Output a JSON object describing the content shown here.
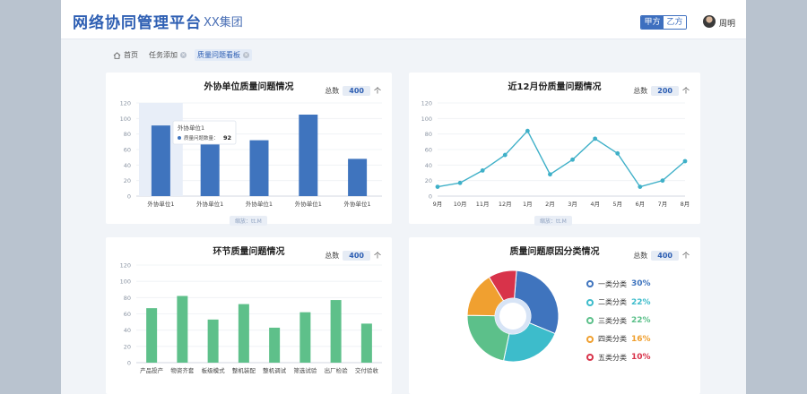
{
  "header": {
    "app_title": "网络协同管理平台",
    "company": "XX集团",
    "party_a": "甲方",
    "party_b": "乙方",
    "user_name": "周明"
  },
  "tabs": [
    {
      "label": "首页",
      "icon": "home-icon"
    },
    {
      "label": "任务添加",
      "closable": true
    },
    {
      "label": "质量问题看板",
      "closable": true,
      "active": true
    }
  ],
  "zoom_hint": "缩放：tt.M",
  "colors": {
    "brand": "#2e5fb3",
    "bar_blue": "#3f74be",
    "line_teal": "#3fb0c8",
    "bar_green": "#5ec08a"
  },
  "chart_data": [
    {
      "type": "bar",
      "title": "外协单位质量问题情况",
      "total_label": "总数",
      "total_value": "400",
      "total_unit": "个",
      "categories": [
        "外协单位1",
        "外协单位1",
        "外协单位1",
        "外协单位1",
        "外协单位1"
      ],
      "values": [
        91,
        68,
        72,
        105,
        48
      ],
      "ylim": [
        0,
        120
      ],
      "yticks": [
        0,
        20,
        40,
        60,
        80,
        100,
        120
      ],
      "tooltip": {
        "title": "外协单位1",
        "label": "质量问题数量：",
        "value": "92"
      }
    },
    {
      "type": "line",
      "title": "近12月份质量问题情况",
      "total_label": "总数",
      "total_value": "200",
      "total_unit": "个",
      "categories": [
        "9月",
        "10月",
        "11月",
        "12月",
        "1月",
        "2月",
        "3月",
        "4月",
        "5月",
        "6月",
        "7月",
        "8月"
      ],
      "values": [
        12,
        17,
        33,
        53,
        84,
        28,
        47,
        74,
        55,
        12,
        20,
        45
      ],
      "ylim": [
        0,
        120
      ],
      "yticks": [
        0,
        20,
        40,
        60,
        80,
        100,
        120
      ]
    },
    {
      "type": "bar",
      "title": "环节质量问题情况",
      "total_label": "总数",
      "total_value": "400",
      "total_unit": "个",
      "categories": [
        "产品投产",
        "物资齐套",
        "板级模式",
        "整机装配",
        "整机调试",
        "筛选试验",
        "出厂检验",
        "交付验收"
      ],
      "values": [
        67,
        82,
        53,
        72,
        43,
        62,
        77,
        48
      ],
      "ylim": [
        0,
        120
      ],
      "yticks": [
        0,
        20,
        40,
        60,
        80,
        100,
        120
      ]
    },
    {
      "type": "pie",
      "title": "质量问题原因分类情况",
      "total_label": "总数",
      "total_value": "400",
      "total_unit": "个",
      "slices": [
        {
          "label": "一类分类",
          "value": 30,
          "pct": "30%",
          "color": "#3f74be"
        },
        {
          "label": "二类分类",
          "value": 22,
          "pct": "22%",
          "color": "#3dbccb"
        },
        {
          "label": "三类分类",
          "value": 22,
          "pct": "22%",
          "color": "#5cc08a"
        },
        {
          "label": "四类分类",
          "value": 16,
          "pct": "16%",
          "color": "#f0a030"
        },
        {
          "label": "五类分类",
          "value": 10,
          "pct": "10%",
          "color": "#d8334a"
        }
      ]
    }
  ]
}
